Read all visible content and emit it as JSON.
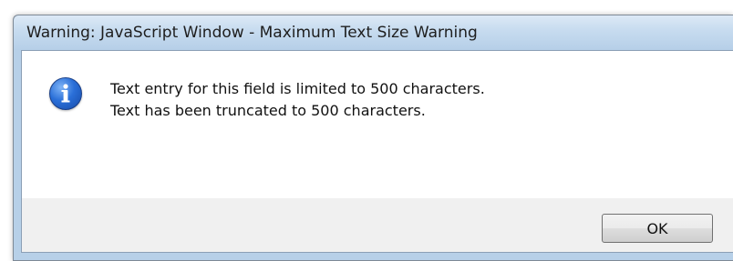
{
  "window": {
    "title": "Warning: JavaScript Window - Maximum Text Size Warning"
  },
  "message": {
    "icon": "info-icon",
    "line1": "Text entry for this field is limited to 500 characters.",
    "line2": "Text has been truncated to 500 characters."
  },
  "buttons": {
    "ok_label": "OK"
  },
  "colors": {
    "titlebar": "#c6dbef",
    "client_background": "#f0f0f0",
    "message_background": "#ffffff",
    "icon_blue": "#2a6fd8"
  }
}
